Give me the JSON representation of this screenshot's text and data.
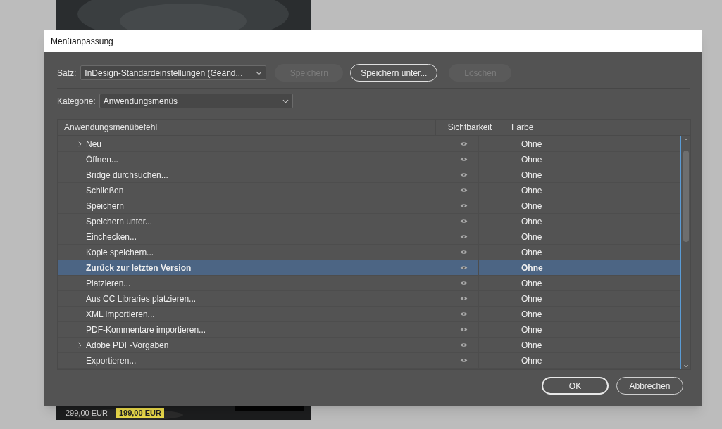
{
  "background": {
    "prices": [
      {
        "kind": "old",
        "text": "299,00 EUR"
      },
      {
        "kind": "sale",
        "text": "199,00 EUR"
      }
    ]
  },
  "dialog": {
    "title": "Menüanpassung",
    "set": {
      "label": "Satz:",
      "value": "InDesign-Standardeinstellungen (Geänd..."
    },
    "set_buttons": [
      {
        "label": "Speichern",
        "disabled": true
      },
      {
        "label": "Speichern unter...",
        "disabled": false
      },
      {
        "label": "Löschen",
        "disabled": true
      }
    ],
    "category": {
      "label": "Kategorie:",
      "value": "Anwendungsmenüs"
    },
    "table": {
      "columns": [
        "Anwendungsmenübefehl",
        "Sichtbarkeit",
        "Farbe"
      ],
      "rows": [
        {
          "name": "Neu",
          "expandable": true,
          "visible": true,
          "farbe": "Ohne",
          "selected": false
        },
        {
          "name": "Öffnen...",
          "expandable": false,
          "visible": true,
          "farbe": "Ohne",
          "selected": false
        },
        {
          "name": "Bridge durchsuchen...",
          "expandable": false,
          "visible": true,
          "farbe": "Ohne",
          "selected": false
        },
        {
          "name": "Schließen",
          "expandable": false,
          "visible": true,
          "farbe": "Ohne",
          "selected": false
        },
        {
          "name": "Speichern",
          "expandable": false,
          "visible": true,
          "farbe": "Ohne",
          "selected": false
        },
        {
          "name": "Speichern unter...",
          "expandable": false,
          "visible": true,
          "farbe": "Ohne",
          "selected": false
        },
        {
          "name": "Einchecken...",
          "expandable": false,
          "visible": true,
          "farbe": "Ohne",
          "selected": false
        },
        {
          "name": "Kopie speichern...",
          "expandable": false,
          "visible": true,
          "farbe": "Ohne",
          "selected": false
        },
        {
          "name": "Zurück zur letzten Version",
          "expandable": false,
          "visible": true,
          "farbe": "Ohne",
          "selected": true
        },
        {
          "name": "Platzieren...",
          "expandable": false,
          "visible": true,
          "farbe": "Ohne",
          "selected": false
        },
        {
          "name": "Aus CC Libraries platzieren...",
          "expandable": false,
          "visible": true,
          "farbe": "Ohne",
          "selected": false
        },
        {
          "name": "XML importieren...",
          "expandable": false,
          "visible": true,
          "farbe": "Ohne",
          "selected": false
        },
        {
          "name": "PDF-Kommentare importieren...",
          "expandable": false,
          "visible": true,
          "farbe": "Ohne",
          "selected": false
        },
        {
          "name": "Adobe PDF-Vorgaben",
          "expandable": true,
          "visible": true,
          "farbe": "Ohne",
          "selected": false
        },
        {
          "name": "Exportieren...",
          "expandable": false,
          "visible": true,
          "farbe": "Ohne",
          "selected": false
        }
      ]
    },
    "buttons": [
      {
        "label": "OK",
        "default": true
      },
      {
        "label": "Abbrechen",
        "default": false
      }
    ]
  }
}
